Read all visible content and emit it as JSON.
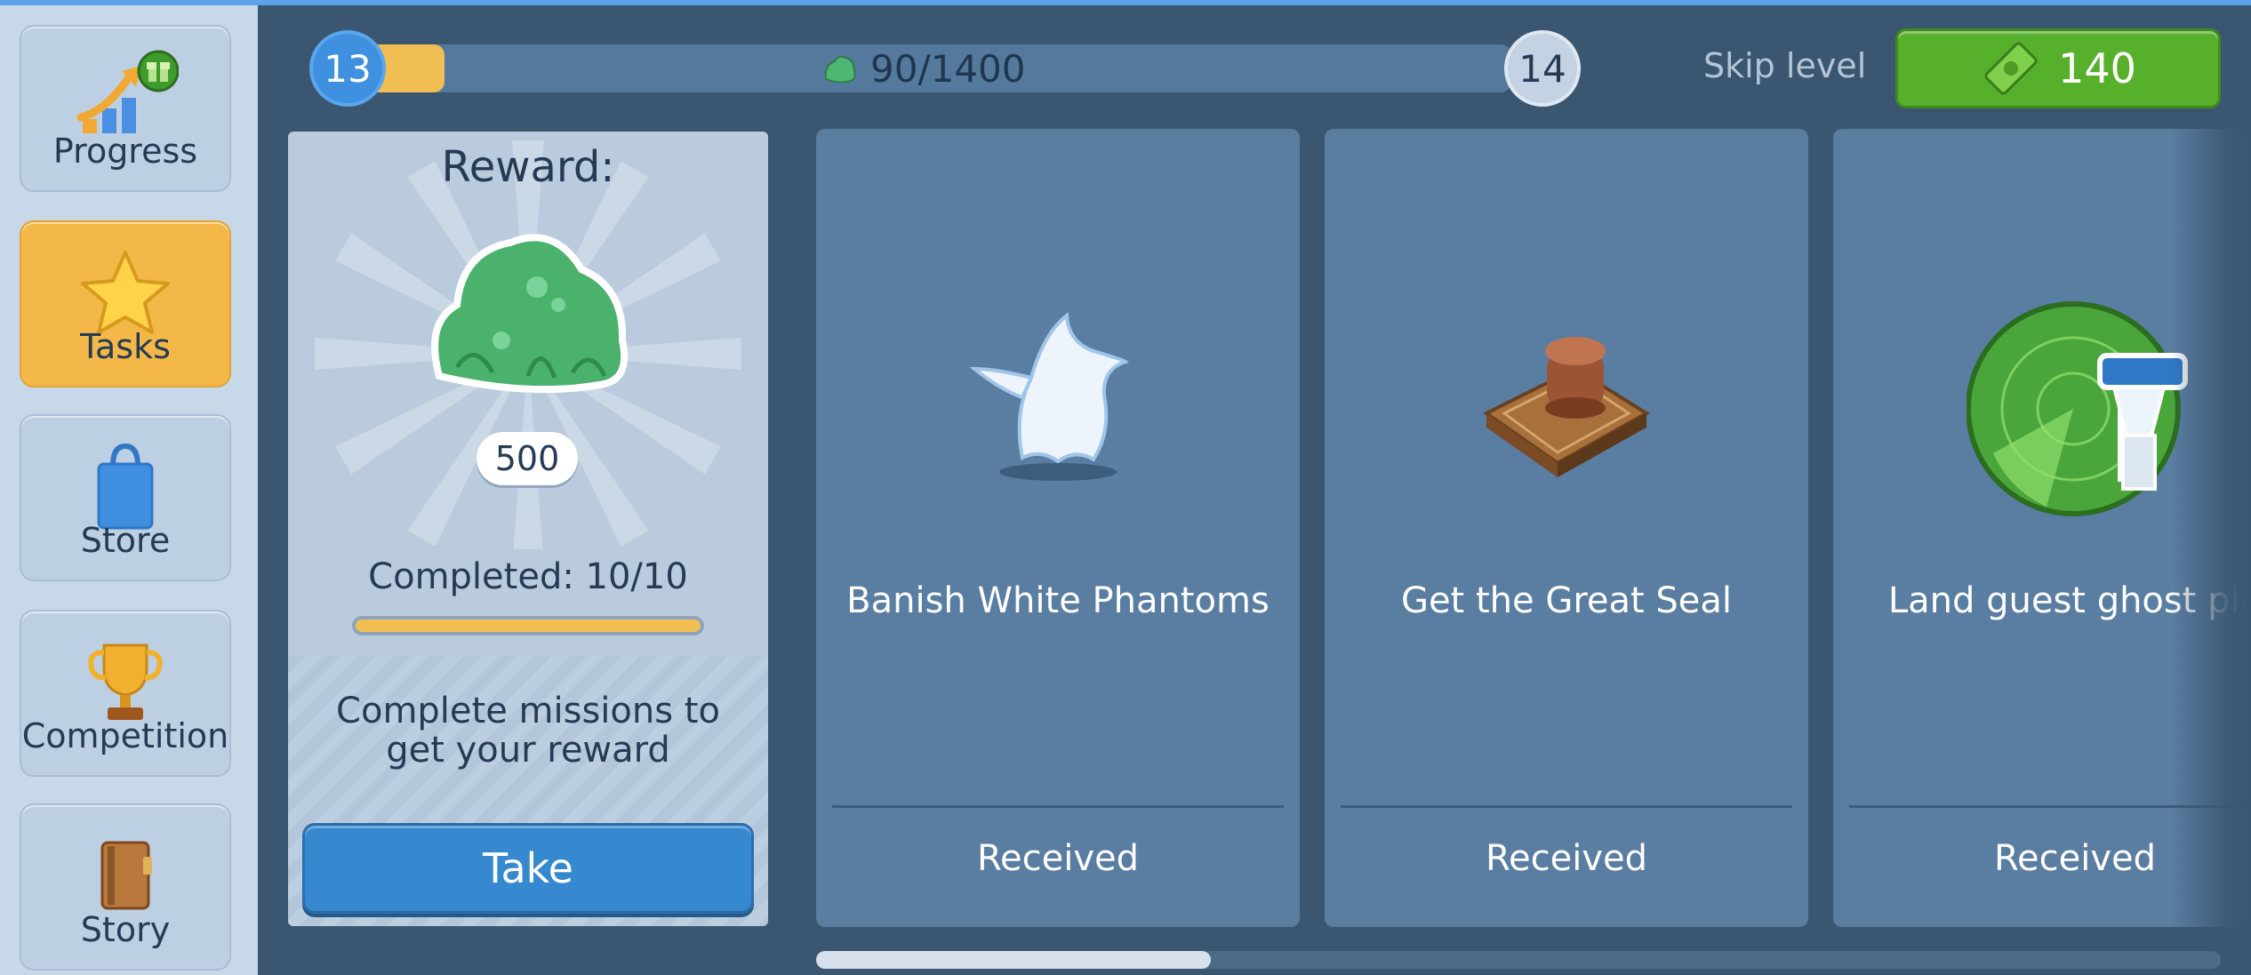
{
  "sidebar": {
    "items": [
      {
        "label": "Progress",
        "icon": "progress-chart-gift-icon",
        "active": false
      },
      {
        "label": "Tasks",
        "icon": "star-icon",
        "active": true
      },
      {
        "label": "Store",
        "icon": "shopping-bag-icon",
        "active": false
      },
      {
        "label": "Competition",
        "icon": "trophy-icon",
        "active": false
      },
      {
        "label": "Story",
        "icon": "book-icon",
        "active": false
      }
    ]
  },
  "topbar": {
    "current_level": "13",
    "next_level": "14",
    "progress_text": "90/1400",
    "progress_fraction": 0.064,
    "skip_label": "Skip level",
    "skip_cost": "140"
  },
  "reward": {
    "title": "Reward:",
    "amount": "500",
    "completed_text": "Completed: 10/10",
    "completed_fraction": 1.0,
    "description": "Complete missions to get your reward",
    "take_label": "Take"
  },
  "tasks": [
    {
      "title": "Banish White Phantoms",
      "status": "Received",
      "icon": "ghost-icon"
    },
    {
      "title": "Get the Great Seal",
      "status": "Received",
      "icon": "seal-stamp-icon"
    },
    {
      "title": "Land guest ghost pla",
      "status": "Received",
      "icon": "radar-tower-icon"
    }
  ],
  "colors": {
    "background": "#3b5670",
    "active_tab": "#f4b848",
    "skip_button": "#57b02c",
    "take_button": "#3688cf",
    "card": "#5a7da2"
  }
}
